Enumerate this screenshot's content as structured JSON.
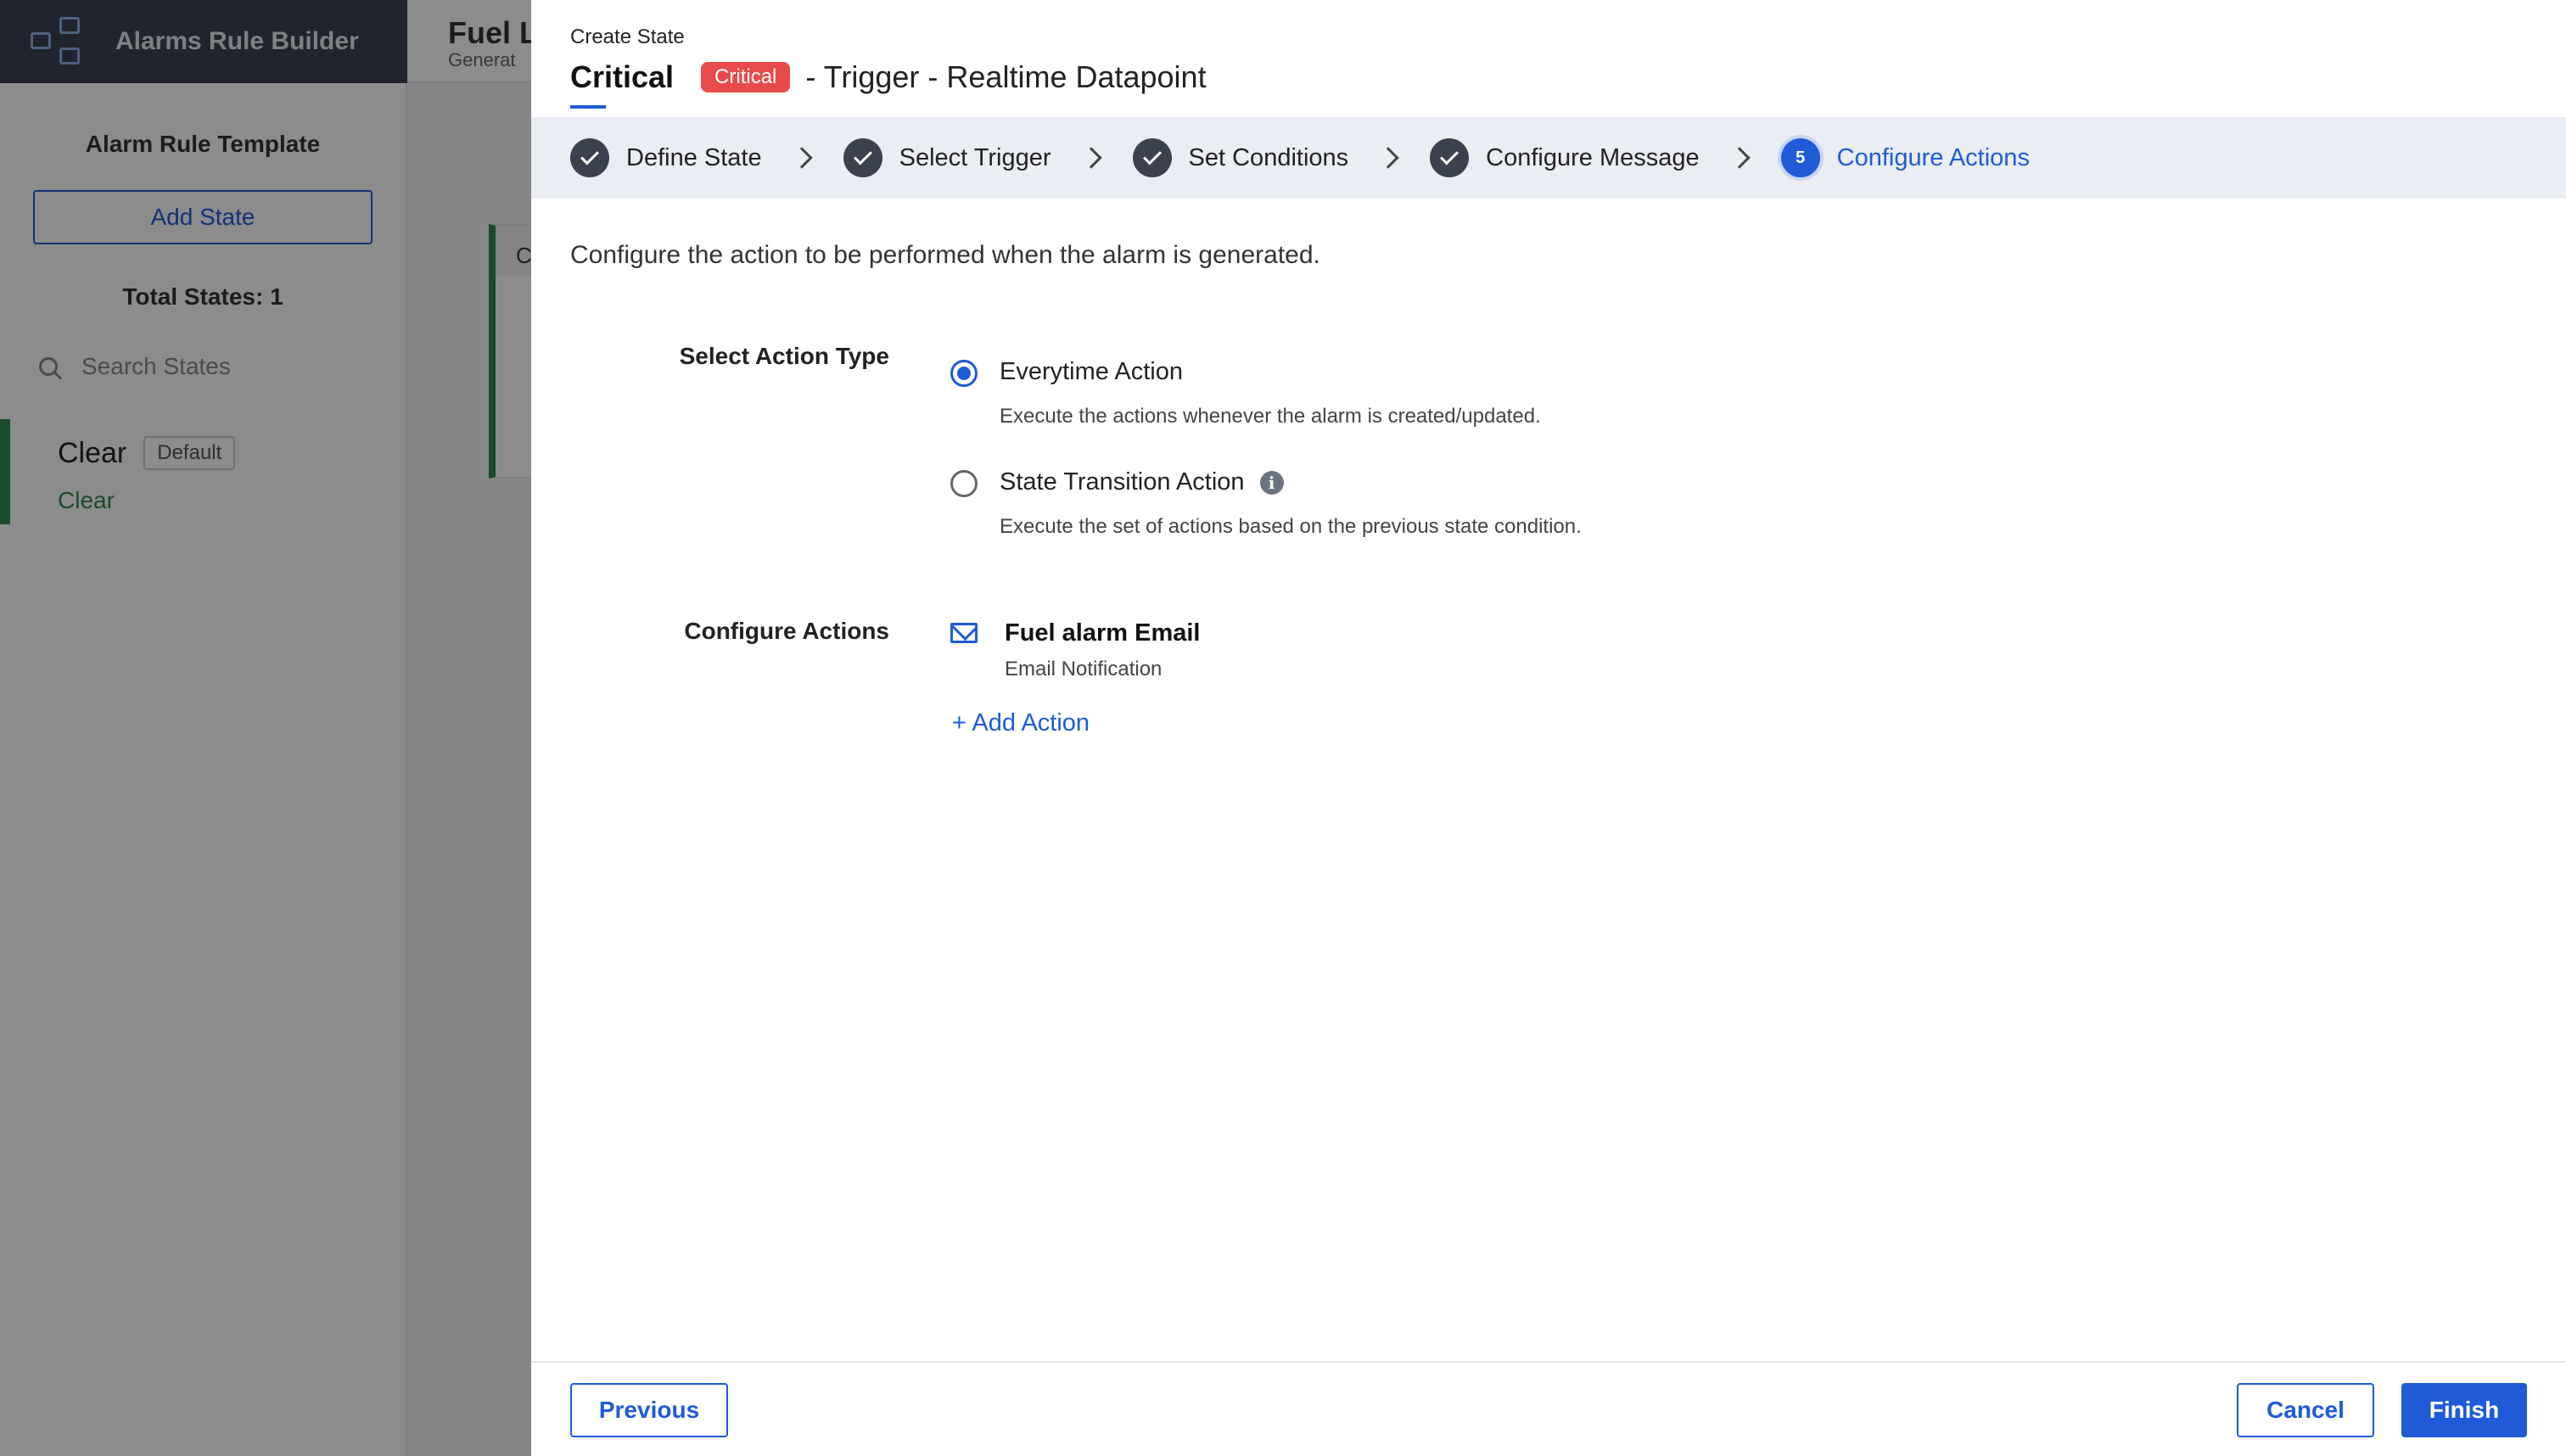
{
  "background": {
    "app_title": "Alarms Rule Builder",
    "sidebar": {
      "heading": "Alarm Rule Template",
      "add_state_label": "Add State",
      "total_states": "Total States: 1",
      "search_placeholder": "Search States",
      "states": [
        {
          "name": "Clear",
          "badge": "Default",
          "sub": "Clear"
        }
      ]
    },
    "main": {
      "title": "Fuel L",
      "subtitle": "Generat",
      "card_head": "C"
    }
  },
  "modal": {
    "pre_title": "Create State",
    "state_name": "Critical",
    "severity_badge": "Critical",
    "trigger_text": "- Trigger - Realtime Datapoint",
    "steps": [
      {
        "label": "Define State",
        "status": "done"
      },
      {
        "label": "Select Trigger",
        "status": "done"
      },
      {
        "label": "Set Conditions",
        "status": "done"
      },
      {
        "label": "Configure Message",
        "status": "done"
      },
      {
        "label": "Configure Actions",
        "status": "active",
        "number": "5"
      }
    ],
    "description": "Configure the action to be performed when the alarm is generated.",
    "action_type": {
      "label": "Select Action Type",
      "options": [
        {
          "title": "Everytime Action",
          "desc": "Execute the actions whenever the alarm is created/updated.",
          "selected": true
        },
        {
          "title": "State Transition Action",
          "desc": "Execute the set of actions based on the previous state condition.",
          "selected": false
        }
      ]
    },
    "configure_actions": {
      "label": "Configure Actions",
      "items": [
        {
          "title": "Fuel alarm Email",
          "type": "Email Notification",
          "icon": "mail-icon"
        }
      ],
      "add_label": "+ Add Action"
    },
    "footer": {
      "previous_label": "Previous",
      "cancel_label": "Cancel",
      "finish_label": "Finish"
    }
  },
  "colors": {
    "accent": "#1f5bd7",
    "critical": "#e84b4b",
    "clear_green": "#2e8a4e"
  }
}
